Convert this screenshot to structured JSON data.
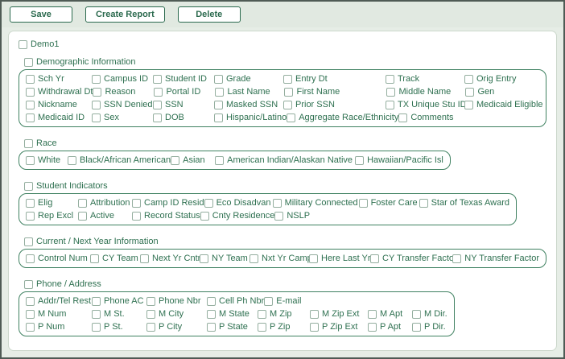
{
  "toolbar": {
    "buttons": [
      {
        "label": "Save"
      },
      {
        "label": "Create Report"
      },
      {
        "label": "Delete"
      }
    ]
  },
  "root_checkbox": {
    "label": "Demo1",
    "checked": false
  },
  "sections": [
    {
      "id": "demographic",
      "label": "Demographic Information",
      "rows": [
        [
          "Sch Yr",
          "Campus ID",
          "Student ID",
          "Grade",
          "Entry Dt",
          "Track",
          "Orig Entry"
        ],
        [
          "Withdrawal Dt",
          "Reason",
          "Portal ID",
          "Last Name",
          "First Name",
          "Middle Name",
          "Gen"
        ],
        [
          "Nickname",
          "SSN Denied",
          "SSN",
          "Masked SSN",
          "Prior SSN",
          "TX Unique Stu ID",
          "Medicaid Eligible"
        ],
        [
          "Medicaid ID",
          "Sex",
          "DOB",
          "Hispanic/Latino",
          "Aggregate Race/Ethnicity",
          "Comments"
        ]
      ]
    },
    {
      "id": "race",
      "label": "Race",
      "rows": [
        [
          "White",
          "Black/African American",
          "Asian",
          "American Indian/Alaskan Native",
          "Hawaiian/Pacific Isl"
        ]
      ]
    },
    {
      "id": "indicators",
      "label": "Student Indicators",
      "rows": [
        [
          "Elig",
          "Attribution",
          "Camp ID Resid",
          "Eco Disadvan",
          "Military Connected",
          "Foster Care",
          "Star of Texas Award"
        ],
        [
          "Rep Excl",
          "Active",
          "Record Status",
          "Cnty Residence",
          "NSLP"
        ]
      ]
    },
    {
      "id": "cnyi",
      "label": "Current / Next Year Information",
      "rows": [
        [
          "Control Num",
          "CY Team",
          "Next Yr Cntrl",
          "NY Team",
          "Nxt Yr Camp",
          "Here Last Yr",
          "CY Transfer Factor",
          "NY Transfer Factor"
        ]
      ]
    },
    {
      "id": "phone",
      "label": "Phone / Address",
      "rows": [
        [
          "Addr/Tel Rest",
          "Phone AC",
          "Phone Nbr",
          "Cell Ph Nbr",
          "E-mail"
        ],
        [
          "M Num",
          "M St.",
          "M City",
          "M State",
          "M Zip",
          "M Zip Ext",
          "M Apt",
          "M Dir."
        ],
        [
          "P Num",
          "P St.",
          "P City",
          "P State",
          "P Zip",
          "P Zip Ext",
          "P Apt",
          "P Dir."
        ]
      ]
    }
  ],
  "checkbox_state": "all_unchecked",
  "colors": {
    "accent": "#2b6a4e",
    "text": "#2e7050",
    "box_border": "#3f8161",
    "toolbar_bg": "#e1e9e1",
    "page_bg": "#e6ede6"
  }
}
